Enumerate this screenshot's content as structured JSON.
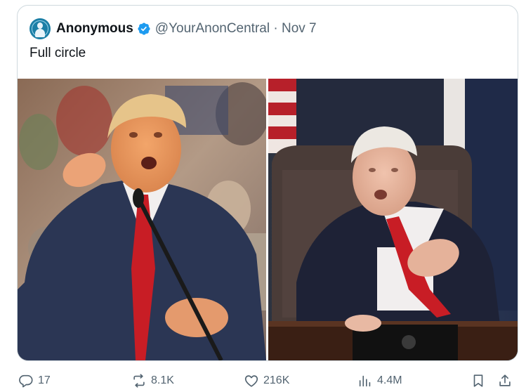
{
  "tweet": {
    "author_name": "Anonymous",
    "handle": "@YourAnonCentral",
    "separator": " · ",
    "date": "Nov 7",
    "text": "Full circle",
    "verified": true
  },
  "media": [
    {
      "icon": "photo",
      "description": "photo-left"
    },
    {
      "icon": "photo",
      "description": "photo-right"
    }
  ],
  "actions": {
    "replies": "17",
    "reposts": "8.1K",
    "likes": "216K",
    "views": "4.4M"
  },
  "colors": {
    "text_primary": "#0f1419",
    "text_secondary": "#536471",
    "verified_blue": "#1d9bf0",
    "border": "#cfd9de"
  }
}
